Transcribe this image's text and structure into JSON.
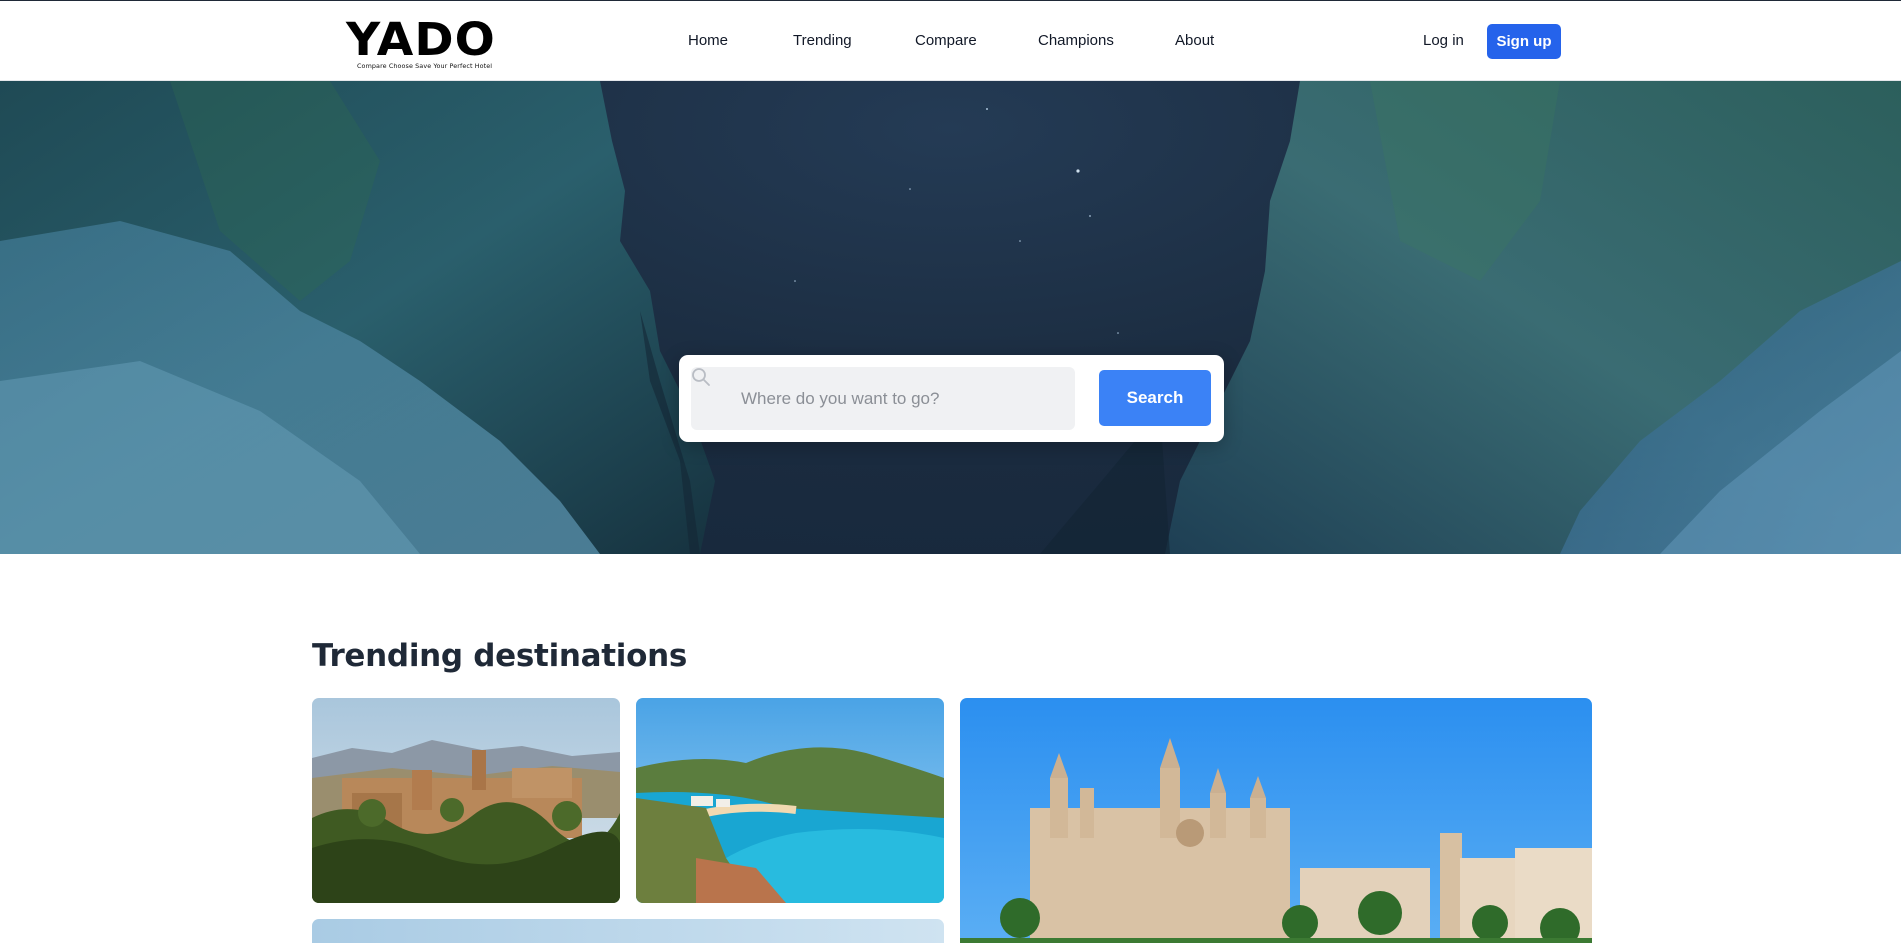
{
  "brand": {
    "name": "YADO",
    "tagline": "Compare Choose Save Your Perfect Hotel"
  },
  "nav": {
    "links": [
      "Home",
      "Trending",
      "Compare",
      "Champions",
      "About"
    ],
    "login_label": "Log in",
    "signup_label": "Sign up"
  },
  "search": {
    "placeholder": "Where do you want to go?",
    "value": "",
    "button_label": "Search"
  },
  "trending": {
    "title": "Trending destinations",
    "cards": [
      {
        "scene": "hilltop fortress palace among trees"
      },
      {
        "scene": "turquoise bay with sandy beach"
      },
      {
        "scene": "gothic cathedral with palm trees"
      },
      {
        "scene": "sky view"
      }
    ]
  },
  "colors": {
    "primary": "#2563eb",
    "search_button": "#3b82f6",
    "hero_sky": "#1b2c40",
    "text": "#1f2937"
  },
  "icons": [
    "search-icon"
  ]
}
